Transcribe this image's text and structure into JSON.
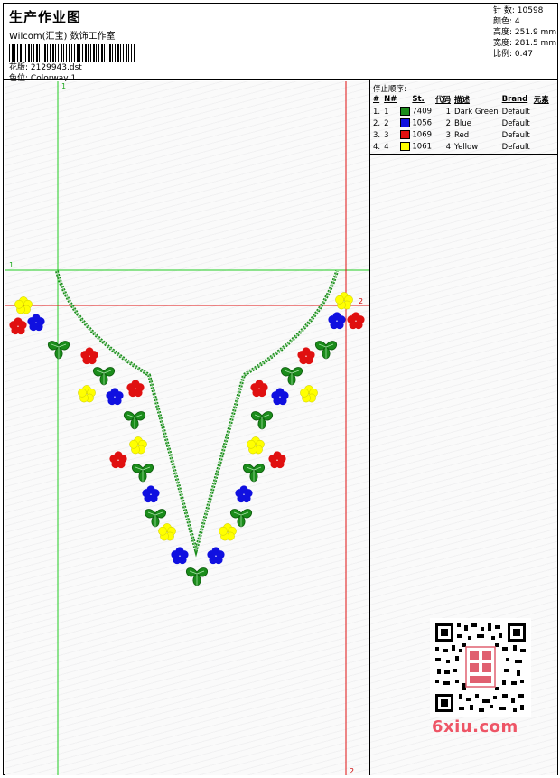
{
  "header": {
    "title": "生产作业图",
    "subtitle": "Wilcom(汇宝) 数饰工作室",
    "design_label": "花版:",
    "design_value": "2129943.dst",
    "colorway_label": "色位:",
    "colorway_value": "Colorway 1"
  },
  "stats": [
    {
      "label": "针 数:",
      "value": "10598"
    },
    {
      "label": "颜色:",
      "value": "4"
    },
    {
      "label": "高度:",
      "value": "251.9 mm"
    },
    {
      "label": "宽度:",
      "value": "281.5 mm"
    },
    {
      "label": "比例:",
      "value": "0.47"
    }
  ],
  "guides": {
    "green_top": "1",
    "green_left": "1",
    "red_right": "2",
    "red_bottom": "2"
  },
  "stop_panel": {
    "title": "停止顺序:",
    "columns": [
      "#",
      "N#",
      "St.",
      "代码",
      "描述",
      "Brand",
      "元素"
    ],
    "rows": [
      {
        "idx": "1.",
        "n": "1",
        "code": "7409",
        "num": "1",
        "desc": "Dark Green",
        "brand": "Default",
        "color": "#1a8c1a"
      },
      {
        "idx": "2.",
        "n": "2",
        "code": "1056",
        "num": "2",
        "desc": "Blue",
        "brand": "Default",
        "color": "#1010e0"
      },
      {
        "idx": "3.",
        "n": "3",
        "code": "1069",
        "num": "3",
        "desc": "Red",
        "brand": "Default",
        "color": "#e01010"
      },
      {
        "idx": "4.",
        "n": "4",
        "code": "1061",
        "num": "4",
        "desc": "Yellow",
        "brand": "Default",
        "color": "#ffff00"
      }
    ]
  },
  "watermark": "6xiu.com",
  "colors": {
    "green": "#1a8c1a",
    "blue": "#1010e0",
    "red": "#e01010",
    "yellow": "#ffff00",
    "guide_green": "#22cc22",
    "guide_red": "#e01010"
  }
}
